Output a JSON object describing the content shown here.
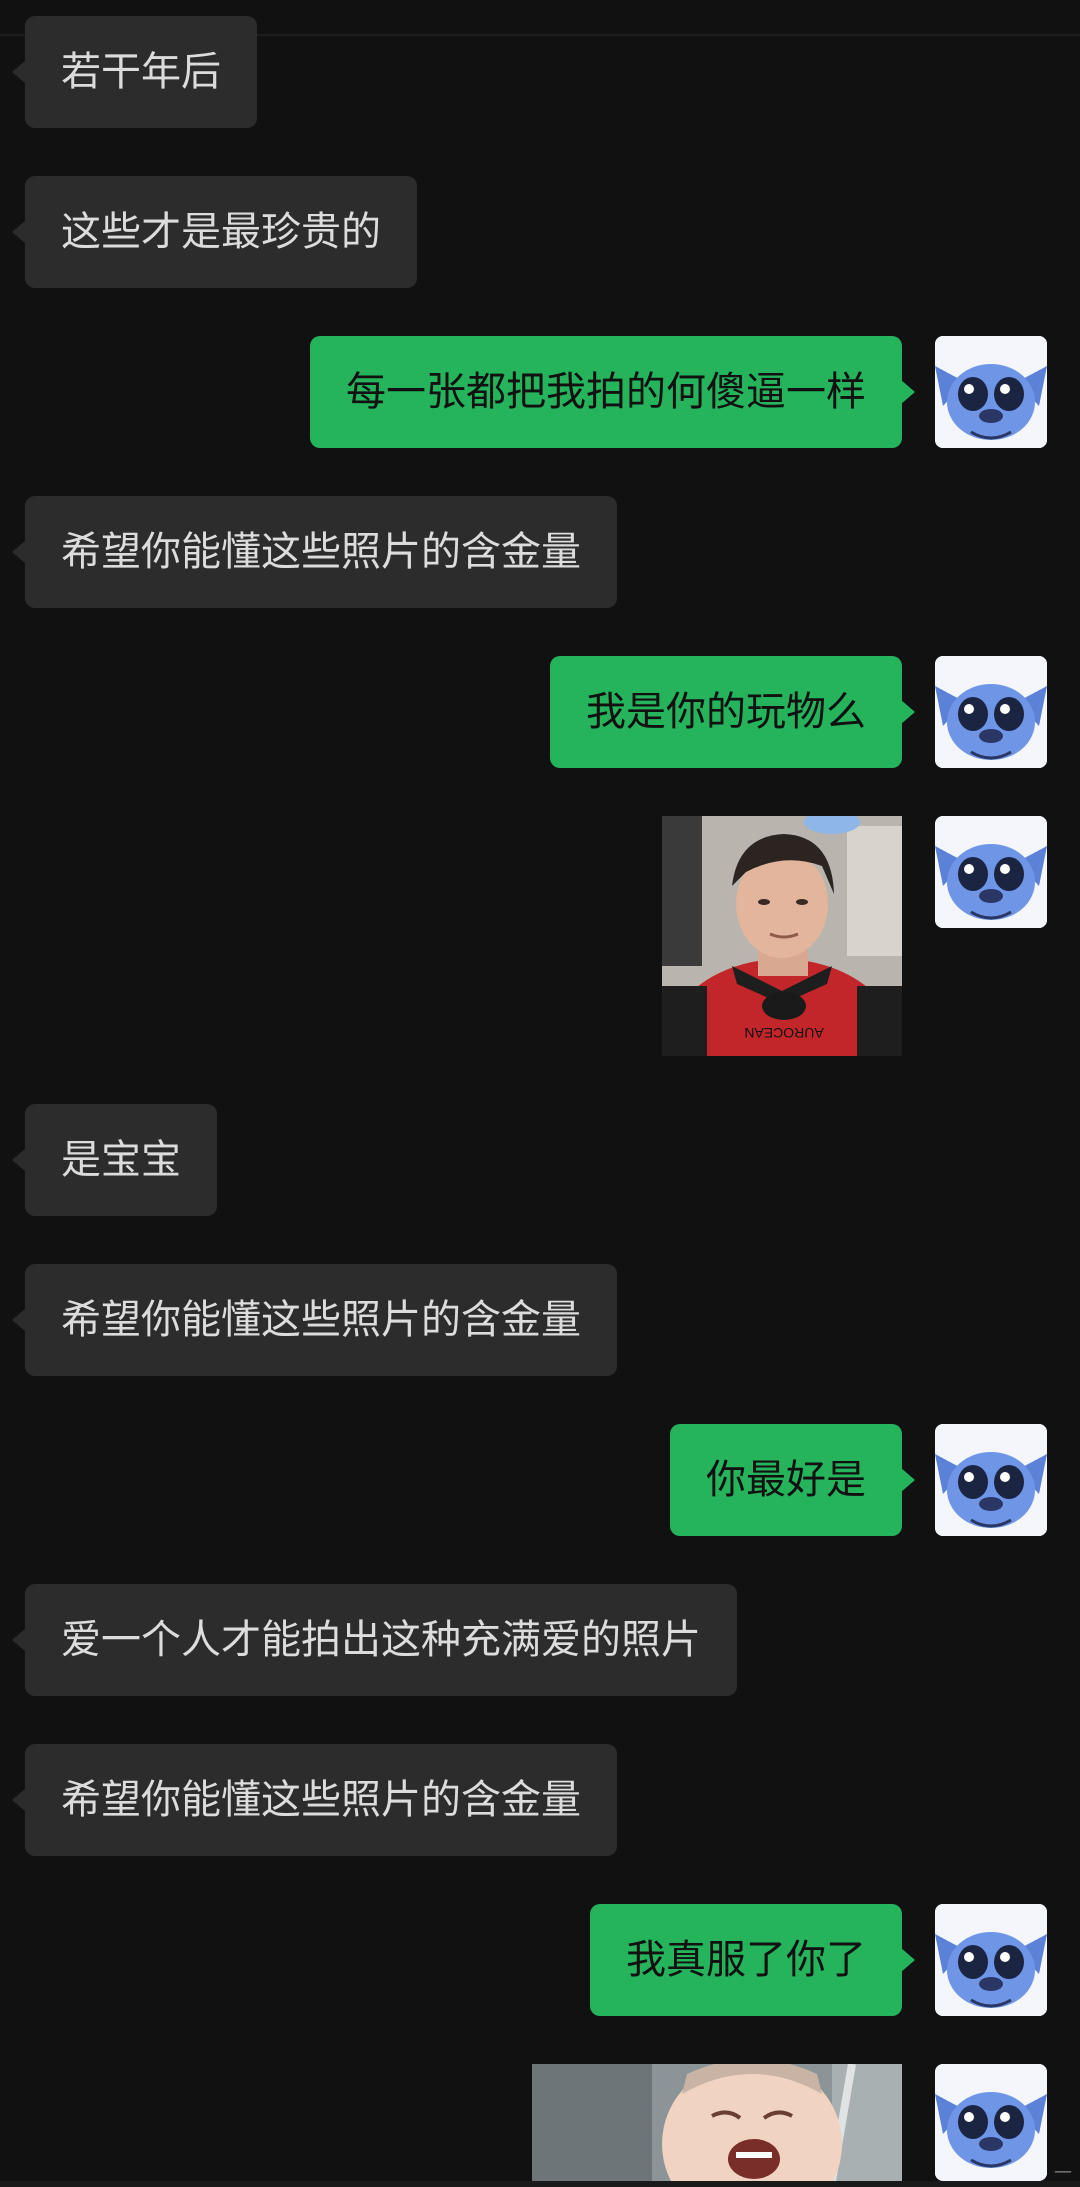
{
  "colors": {
    "background": "#111111",
    "received_bubble": "#2c2c2c",
    "received_text": "#dcdcdc",
    "sent_bubble": "#25b35c",
    "sent_text": "#111111"
  },
  "avatar": {
    "icon": "stitch-avatar-icon"
  },
  "messages": [
    {
      "type": "text",
      "from": "other",
      "text": "若干年后"
    },
    {
      "type": "text",
      "from": "other",
      "text": "这些才是最珍贵的"
    },
    {
      "type": "text",
      "from": "me",
      "text": "每一张都把我拍的何傻逼一样"
    },
    {
      "type": "text",
      "from": "other",
      "text": "希望你能懂这些照片的含金量"
    },
    {
      "type": "text",
      "from": "me",
      "text": "我是你的玩物么"
    },
    {
      "type": "image",
      "from": "me",
      "icon": "boy-in-red-sweater-photo",
      "caption": "AUROCEAN"
    },
    {
      "type": "text",
      "from": "other",
      "text": "是宝宝"
    },
    {
      "type": "text",
      "from": "other",
      "text": "希望你能懂这些照片的含金量"
    },
    {
      "type": "text",
      "from": "me",
      "text": "你最好是"
    },
    {
      "type": "text",
      "from": "other",
      "text": "爱一个人才能拍出这种充满爱的照片"
    },
    {
      "type": "text",
      "from": "other",
      "text": "希望你能懂这些照片的含金量"
    },
    {
      "type": "text",
      "from": "me",
      "text": "我真服了你了"
    },
    {
      "type": "image",
      "from": "me",
      "icon": "crying-baby-photo"
    }
  ],
  "footer": {
    "mark": "—"
  }
}
